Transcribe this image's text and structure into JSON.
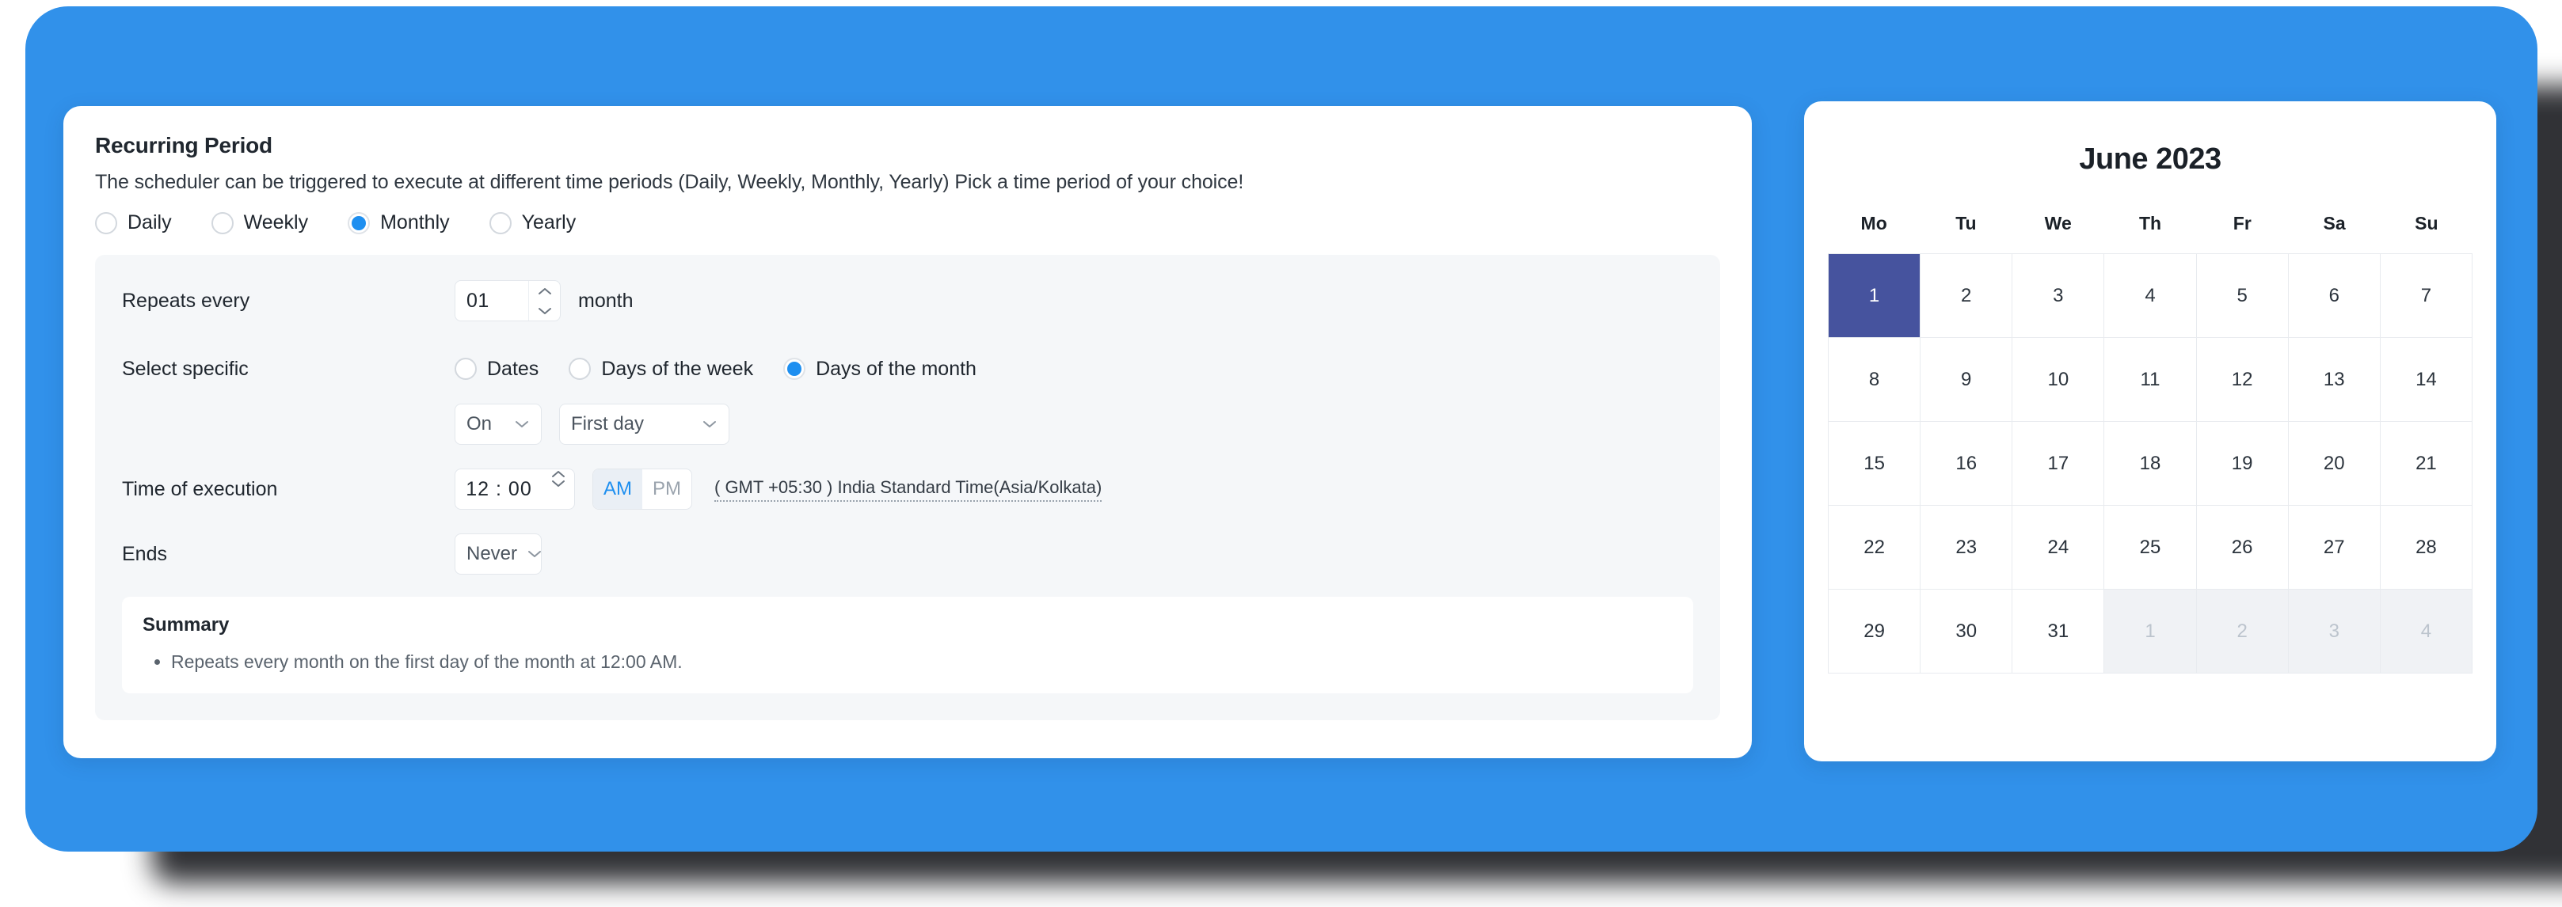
{
  "theme": {
    "backdrop_blue": "#3191ea",
    "accent_blue": "#1e8ff0",
    "selected_day_indigo": "#46539e",
    "panel_gray": "#f5f7f9"
  },
  "settings": {
    "title": "Recurring Period",
    "description": "The scheduler can be triggered to execute at different time periods (Daily, Weekly, Monthly, Yearly) Pick a time period of your choice!",
    "period_options": [
      {
        "label": "Daily",
        "selected": false
      },
      {
        "label": "Weekly",
        "selected": false
      },
      {
        "label": "Monthly",
        "selected": true
      },
      {
        "label": "Yearly",
        "selected": false
      }
    ],
    "repeats_every": {
      "label": "Repeats every",
      "value": "01",
      "unit": "month"
    },
    "select_specific": {
      "label": "Select specific",
      "options": [
        {
          "label": "Dates",
          "selected": false
        },
        {
          "label": "Days of the week",
          "selected": false
        },
        {
          "label": "Days of the month",
          "selected": true
        }
      ],
      "on_select": "On",
      "day_select": "First day"
    },
    "time_of_execution": {
      "label": "Time of execution",
      "value": "12 : 00",
      "meridiem_am": "AM",
      "meridiem_pm": "PM",
      "meridiem_selected": "AM",
      "timezone": "( GMT +05:30 ) India Standard Time(Asia/Kolkata)"
    },
    "ends": {
      "label": "Ends",
      "value": "Never"
    },
    "summary": {
      "title": "Summary",
      "items": [
        "Repeats every month on the first day of the month at 12:00 AM."
      ]
    }
  },
  "calendar": {
    "title": "June 2023",
    "weekdays": [
      "Mo",
      "Tu",
      "We",
      "Th",
      "Fr",
      "Sa",
      "Su"
    ],
    "days": [
      {
        "n": "1",
        "state": "selected"
      },
      {
        "n": "2",
        "state": "normal"
      },
      {
        "n": "3",
        "state": "normal"
      },
      {
        "n": "4",
        "state": "normal"
      },
      {
        "n": "5",
        "state": "normal"
      },
      {
        "n": "6",
        "state": "normal"
      },
      {
        "n": "7",
        "state": "normal"
      },
      {
        "n": "8",
        "state": "normal"
      },
      {
        "n": "9",
        "state": "normal"
      },
      {
        "n": "10",
        "state": "normal"
      },
      {
        "n": "11",
        "state": "normal"
      },
      {
        "n": "12",
        "state": "normal"
      },
      {
        "n": "13",
        "state": "normal"
      },
      {
        "n": "14",
        "state": "normal"
      },
      {
        "n": "15",
        "state": "normal"
      },
      {
        "n": "16",
        "state": "normal"
      },
      {
        "n": "17",
        "state": "normal"
      },
      {
        "n": "18",
        "state": "normal"
      },
      {
        "n": "19",
        "state": "normal"
      },
      {
        "n": "20",
        "state": "normal"
      },
      {
        "n": "21",
        "state": "normal"
      },
      {
        "n": "22",
        "state": "normal"
      },
      {
        "n": "23",
        "state": "normal"
      },
      {
        "n": "24",
        "state": "normal"
      },
      {
        "n": "25",
        "state": "normal"
      },
      {
        "n": "26",
        "state": "normal"
      },
      {
        "n": "27",
        "state": "normal"
      },
      {
        "n": "28",
        "state": "normal"
      },
      {
        "n": "29",
        "state": "normal"
      },
      {
        "n": "30",
        "state": "normal"
      },
      {
        "n": "31",
        "state": "normal"
      },
      {
        "n": "1",
        "state": "muted"
      },
      {
        "n": "2",
        "state": "muted"
      },
      {
        "n": "3",
        "state": "muted"
      },
      {
        "n": "4",
        "state": "muted"
      }
    ]
  },
  "icons": {
    "spinner_up": "chevron-up-icon",
    "spinner_down": "chevron-down-icon",
    "select_chevron": "chevron-down-icon"
  }
}
